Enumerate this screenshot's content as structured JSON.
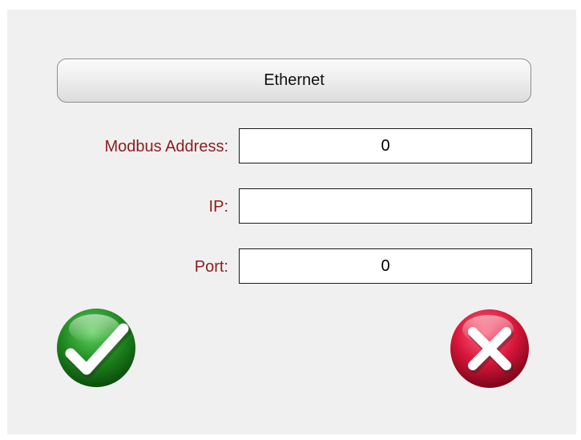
{
  "header": {
    "mode_label": "Ethernet"
  },
  "fields": {
    "modbus_address": {
      "label": "Modbus Address:",
      "value": "0"
    },
    "ip": {
      "label": "IP:",
      "value": ""
    },
    "port": {
      "label": "Port:",
      "value": "0"
    }
  },
  "actions": {
    "confirm_icon": "checkmark-icon",
    "cancel_icon": "close-icon"
  },
  "colors": {
    "label_text": "#8b1e1e",
    "confirm_green": "#1f8a1f",
    "cancel_red": "#d8163a",
    "background": "#f0f0f0"
  }
}
